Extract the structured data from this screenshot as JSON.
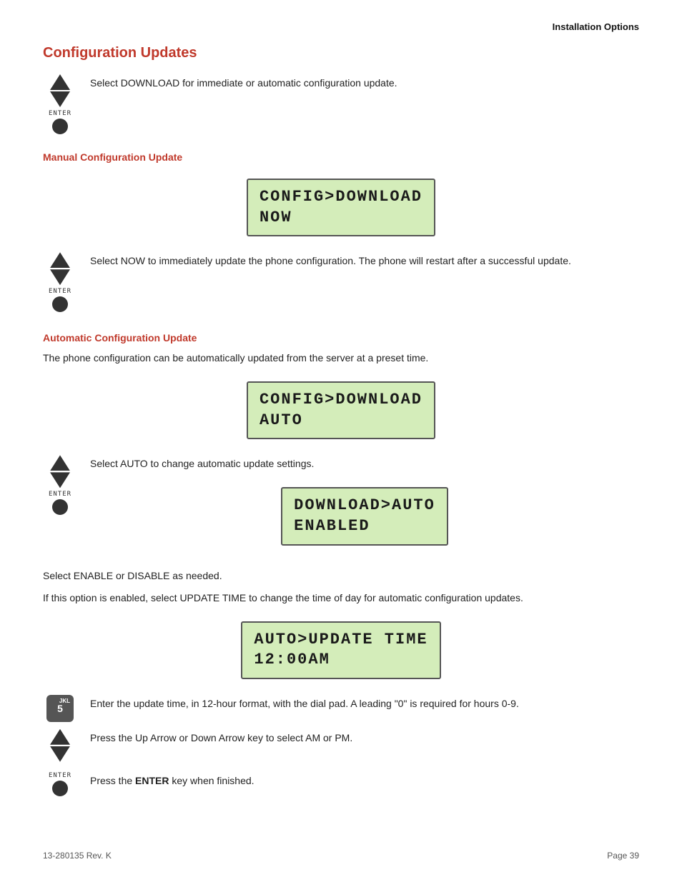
{
  "header": {
    "title": "Installation Options"
  },
  "main_section": {
    "title": "Configuration Updates",
    "intro_text": "Select DOWNLOAD for immediate or automatic configuration update."
  },
  "manual_section": {
    "title": "Manual Configuration Update",
    "lcd1": {
      "line1": "CONFIG>DOWNLOAD",
      "line2": "NOW"
    },
    "text": "Select NOW to immediately update the phone configuration. The phone will restart after a successful update."
  },
  "auto_section": {
    "title": "Automatic Configuration Update",
    "intro": "The phone configuration can be automatically updated from the server at a preset time.",
    "lcd2": {
      "line1": "CONFIG>DOWNLOAD",
      "line2": "AUTO"
    },
    "select_auto_text": "Select AUTO to change automatic update settings.",
    "lcd3": {
      "line1": "DOWNLOAD>AUTO",
      "line2": "ENABLED"
    },
    "enable_text": "Select ENABLE or DISABLE as needed.",
    "update_time_text": "If this option is enabled, select UPDATE TIME to change the time of day for automatic configuration updates.",
    "lcd4": {
      "line1": "AUTO>UPDATE TIME",
      "line2": "12:00AM"
    },
    "dial_key": "5",
    "dial_key_sup": "JKL",
    "enter_time_text": "Enter the update time, in 12-hour format, with the dial pad. A leading \"0\" is required for hours 0-9.",
    "arrow_text": "Press the Up Arrow or Down Arrow key to select AM or PM.",
    "enter_text_pre": "Press the ",
    "enter_bold": "ENTER",
    "enter_text_post": " key when finished."
  },
  "footer": {
    "left": "13-280135  Rev. K",
    "right": "Page 39"
  }
}
